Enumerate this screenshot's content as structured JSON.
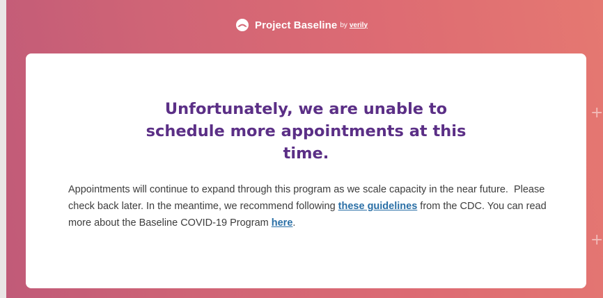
{
  "header": {
    "logo_icon": "project-baseline-logo-icon",
    "brand_name": "Project Baseline",
    "brand_by": "by",
    "brand_verily": "verily"
  },
  "card": {
    "title": "Unfortunately, we are unable to schedule more appointments at this time.",
    "body_part1": "Appointments will continue to expand through this program as we scale capacity in the near future.  Please check back later. In the meantime, we recommend following ",
    "link_guidelines": "these guidelines",
    "body_part2": " from the CDC. You can read more about the Baseline COVID-19 Program ",
    "link_here": "here",
    "body_part3": "."
  },
  "decor": {
    "plus_icon": "+"
  },
  "colors": {
    "background_start": "#c05a78",
    "background_end": "#e57871",
    "title": "#5b2f86",
    "link": "#2a6fa6",
    "body_text": "#3c3c3c"
  }
}
